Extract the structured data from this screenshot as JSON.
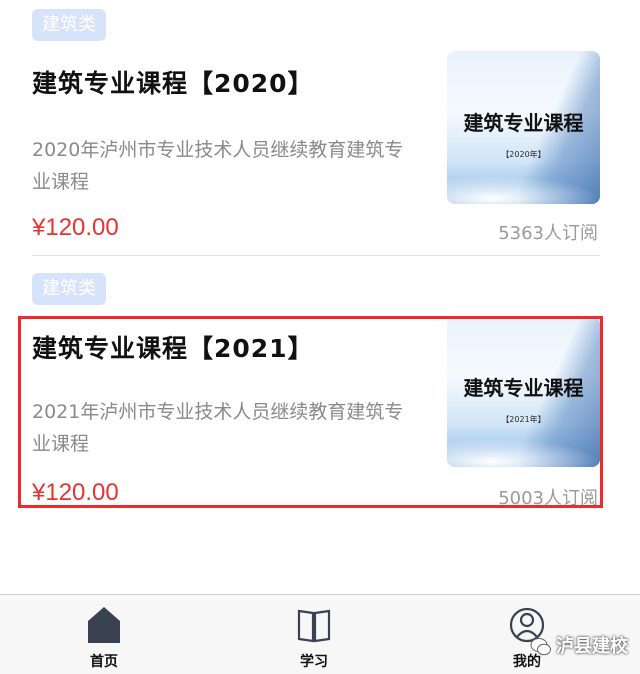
{
  "courses": [
    {
      "tag": "建筑类",
      "title": "建筑专业课程【2020】",
      "description": "2020年泸州市专业技术人员继续教育建筑专业课程",
      "price": "¥120.00",
      "subscribers": "5363人订阅",
      "cover": {
        "title": "建筑专业课程",
        "year": "【2020年】"
      }
    },
    {
      "tag": "建筑类",
      "title": "建筑专业课程【2021】",
      "description": "2021年泸州市专业技术人员继续教育建筑专业课程",
      "price": "¥120.00",
      "subscribers": "5003人订阅",
      "cover": {
        "title": "建筑专业课程",
        "year": "【2021年】"
      }
    }
  ],
  "tabbar": {
    "items": [
      {
        "label": "首页",
        "icon": "home-icon",
        "active": true
      },
      {
        "label": "学习",
        "icon": "book-icon",
        "active": false
      },
      {
        "label": "我的",
        "icon": "user-icon",
        "active": false
      }
    ]
  },
  "watermark": {
    "text": "泸县建校"
  },
  "colors": {
    "price": "#e5342f",
    "tag_bg": "#d7e2fb",
    "highlight": "#ee2a2a"
  }
}
